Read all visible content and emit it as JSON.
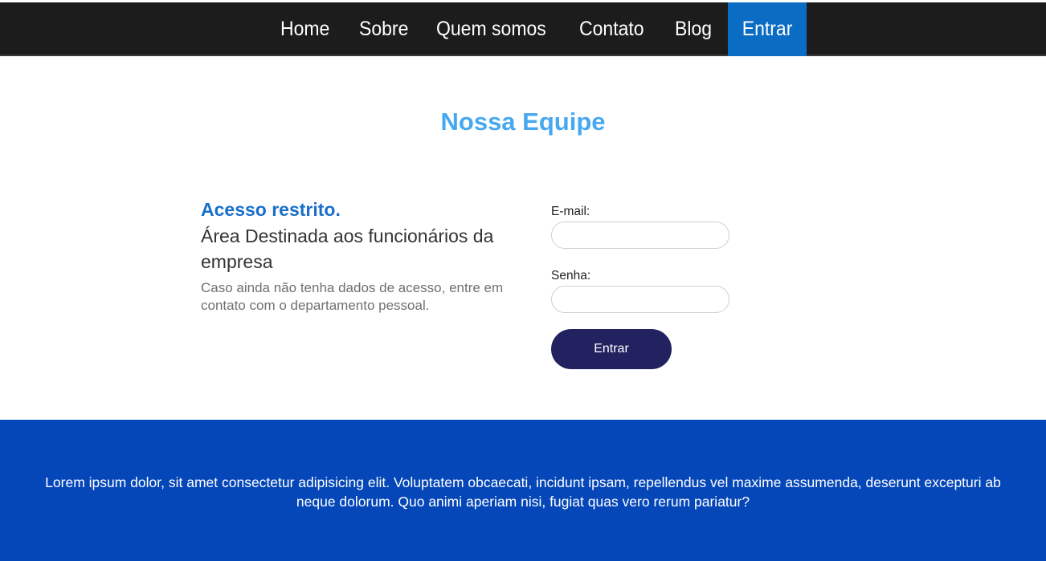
{
  "nav": {
    "items": [
      {
        "label": "Home"
      },
      {
        "label": "Sobre"
      },
      {
        "label": "Quem somos"
      },
      {
        "label": "Contato"
      },
      {
        "label": "Blog"
      },
      {
        "label": "Entrar",
        "active": true
      }
    ]
  },
  "page": {
    "title": "Nossa Equipe"
  },
  "info": {
    "heading": "Acesso restrito.",
    "subheading": "Área Destinada aos funcionários da empresa",
    "note": "Caso ainda não tenha dados de acesso, entre em contato com o departamento pessoal."
  },
  "login_form": {
    "email_label": "E-mail:",
    "email_value": "",
    "password_label": "Senha:",
    "password_value": "",
    "submit_label": "Entrar"
  },
  "footer": {
    "text": "Lorem ipsum dolor, sit amet consectetur adipisicing elit. Voluptatem obcaecati, incidunt ipsam, repellendus vel maxime assumenda, deserunt excepturi ab neque dolorum. Quo animi aperiam nisi, fugiat quas vero rerum pariatur?"
  },
  "colors": {
    "nav_background": "#1c1c1c",
    "nav_active": "#0b6cc4",
    "title": "#46a8f0",
    "heading": "#1a6fc9",
    "button": "#232260",
    "footer_background": "#0547b8"
  }
}
